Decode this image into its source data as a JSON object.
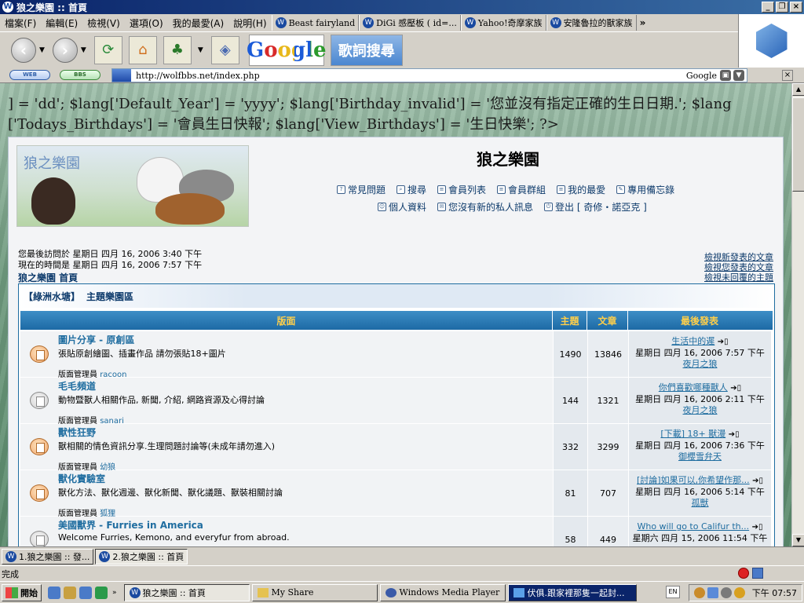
{
  "window": {
    "title": "狼之樂園 :: 首頁",
    "app_icon_letter": "W"
  },
  "menu": [
    "檔案(F)",
    "編輯(E)",
    "檢視(V)",
    "選項(O)",
    "我的最愛(A)",
    "說明(H)"
  ],
  "bookmarks": [
    "Beast fairyland",
    "DiGi 感壓板 ( id=...",
    "Yahoo!奇摩家族",
    "安隆魯拉的獸家族"
  ],
  "bookmarks_more": "»",
  "toolbar": {
    "back_glyph": "‹",
    "forward_glyph": "›",
    "google_label": "Google",
    "lyrics_label": "歌詞搜尋"
  },
  "address": {
    "pill_web": "WEB",
    "pill_bbs": "BBS",
    "url": "http://wolfbbs.net/index.php",
    "search_label": "Google",
    "close": "×"
  },
  "page": {
    "php_text": "] = 'dd'; $lang['Default_Year'] = 'yyyy'; $lang['Birthday_invalid'] = '您並沒有指定正確的生日日期.'; $lang ['Todays_Birthdays'] = '會員生日快報'; $lang['View_Birthdays'] = '生日快樂'; ?>",
    "banner_text": "狼之樂園",
    "site_title": "狼之樂園",
    "nav_row1": [
      "常見問題",
      "搜尋",
      "會員列表",
      "會員群組",
      "我的最愛",
      "專用備忘錄"
    ],
    "nav_row2": [
      "個人資料",
      "您沒有新的私人訊息",
      "登出 [ 奇修・諾亞克 ]"
    ],
    "last_visit": "您最後訪問於 星期日 四月 16, 2006 3:40 下午",
    "now_time": "現在的時間是 星期日 四月 16, 2006 7:57 下午",
    "breadcrumb": "狼之樂園 首頁",
    "right_links": [
      "檢視新發表的文章",
      "檢視您發表的文章",
      "檢視未回覆的主題"
    ],
    "category_prefix": "【綠洲水塘】",
    "category_name": "主題樂園區",
    "table_headers": {
      "forum": "版面",
      "topics": "主題",
      "posts": "文章",
      "last": "最後發表"
    },
    "moderator_label": "版面管理員",
    "forums": [
      {
        "name": "圖片分享 - 原創區",
        "desc": "張貼原創繪圖、插畫作品 請勿張貼18+圖片",
        "mod": "racoon",
        "topics": "1490",
        "posts": "13846",
        "last_title": "生活中的遲",
        "last_time": "星期日 四月 16, 2006 7:57 下午",
        "last_user": "夜月之狼",
        "icon": "new"
      },
      {
        "name": "毛毛頻道",
        "desc": "動物暨獸人相關作品, 新聞, 介紹, 網路資源及心得討論",
        "mod": "sanari",
        "topics": "144",
        "posts": "1321",
        "last_title": "你們喜歡哪種獸人",
        "last_time": "星期日 四月 16, 2006 2:11 下午",
        "last_user": "夜月之狼",
        "icon": "old"
      },
      {
        "name": "獸性狂野",
        "desc": "獸相關的情色資訊分享.生理問題討論等(未成年請勿進入)",
        "mod": "幼狼",
        "topics": "332",
        "posts": "3299",
        "last_title": "[下載] 18+ 獸漫",
        "last_time": "星期日 四月 16, 2006 7:36 下午",
        "last_user": "御櫻雪弁天",
        "icon": "new"
      },
      {
        "name": "獸化實驗室",
        "desc": "獸化方法、獸化週邊、獸化新聞、獸化議題、獸裝相關討論",
        "mod": "狐狸",
        "topics": "81",
        "posts": "707",
        "last_title": "[討論]如果可以,你希望作那...",
        "last_time": "星期日 四月 16, 2006 5:14 下午",
        "last_user": "孤獣",
        "icon": "new"
      },
      {
        "name": "美國獸界 - Furries in America",
        "desc": "Welcome Furries, Kemono, and everyfur from abroad.",
        "mod": "",
        "topics": "58",
        "posts": "449",
        "last_title": "Who will go to Califur th...",
        "last_time": "星期六 四月 15, 2006 11:54 下午",
        "last_user": "",
        "icon": "old"
      }
    ]
  },
  "browser_tabs": [
    "1.狼之樂園 :: 發...",
    "2.狼之樂園 :: 首頁"
  ],
  "status": "完成",
  "taskbar": {
    "start": "開始",
    "tasks": [
      "狼之樂園 :: 首頁",
      "My Share",
      "Windows Media Player",
      "伏俱.跟家裡那隻一起封..."
    ],
    "lang": "EN",
    "clock": "下午 07:57"
  },
  "colors": {
    "accent": "#1f6da0",
    "header_gold": "#ffcf4a",
    "titlebar": "#0a246a"
  }
}
